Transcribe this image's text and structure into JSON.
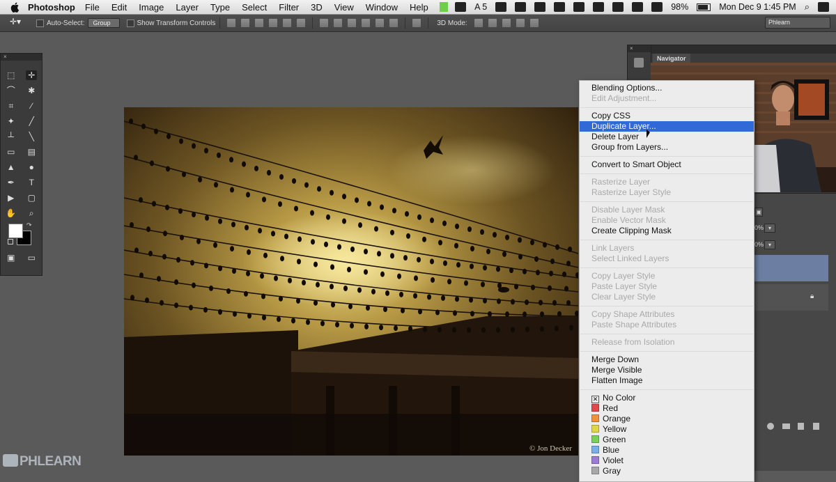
{
  "menubar": {
    "app": "Photoshop",
    "items": [
      "File",
      "Edit",
      "Image",
      "Layer",
      "Type",
      "Select",
      "Filter",
      "3D",
      "View",
      "Window",
      "Help"
    ],
    "status": {
      "adobe_badge": "5",
      "battery": "98%",
      "datetime": "Mon Dec 9  1:45 PM"
    }
  },
  "options": {
    "auto_select_label": "Auto-Select:",
    "auto_select_value": "Group",
    "transform_label": "Show Transform Controls",
    "mode_label": "3D Mode:",
    "workspace": "Phlearn"
  },
  "navigator": {
    "tab": "Navigator"
  },
  "canvas": {
    "credit": "© Jon Decker"
  },
  "layers": {
    "opacity": "0%",
    "fill": "0%"
  },
  "context_menu": {
    "items": [
      {
        "label": "Blending Options...",
        "disabled": false
      },
      {
        "label": "Edit Adjustment...",
        "disabled": true
      },
      {
        "label": "Copy CSS",
        "disabled": false
      },
      {
        "label": "Duplicate Layer...",
        "disabled": false,
        "highlighted": true
      },
      {
        "label": "Delete Layer",
        "disabled": false
      },
      {
        "label": "Group from Layers...",
        "disabled": false
      },
      {
        "label": "Convert to Smart Object",
        "disabled": false
      },
      {
        "label": "Rasterize Layer",
        "disabled": true
      },
      {
        "label": "Rasterize Layer Style",
        "disabled": true
      },
      {
        "label": "Disable Layer Mask",
        "disabled": true
      },
      {
        "label": "Enable Vector Mask",
        "disabled": true
      },
      {
        "label": "Create Clipping Mask",
        "disabled": false
      },
      {
        "label": "Link Layers",
        "disabled": true
      },
      {
        "label": "Select Linked Layers",
        "disabled": true
      },
      {
        "label": "Copy Layer Style",
        "disabled": true
      },
      {
        "label": "Paste Layer Style",
        "disabled": true
      },
      {
        "label": "Clear Layer Style",
        "disabled": true
      },
      {
        "label": "Copy Shape Attributes",
        "disabled": true
      },
      {
        "label": "Paste Shape Attributes",
        "disabled": true
      },
      {
        "label": "Release from Isolation",
        "disabled": true
      },
      {
        "label": "Merge Down",
        "disabled": false
      },
      {
        "label": "Merge Visible",
        "disabled": false
      },
      {
        "label": "Flatten Image",
        "disabled": false
      }
    ],
    "colors": [
      {
        "label": "No Color",
        "color": ""
      },
      {
        "label": "Red",
        "color": "#e0484b"
      },
      {
        "label": "Orange",
        "color": "#f0923a"
      },
      {
        "label": "Yellow",
        "color": "#dfd64a"
      },
      {
        "label": "Green",
        "color": "#7cd05a"
      },
      {
        "label": "Blue",
        "color": "#7aaee8"
      },
      {
        "label": "Violet",
        "color": "#9c7bd6"
      },
      {
        "label": "Gray",
        "color": "#a8a8a8"
      }
    ]
  },
  "watermark": "PHLEARN"
}
